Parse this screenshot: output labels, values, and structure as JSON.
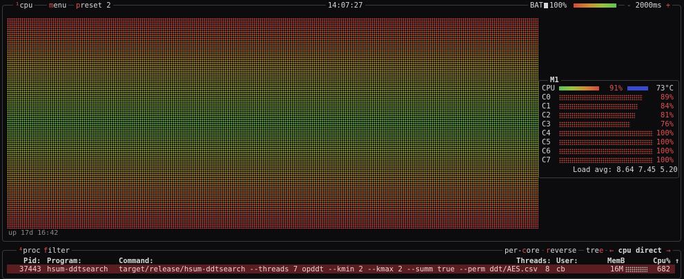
{
  "top": {
    "cpu_hotkey": "¹",
    "cpu_label": "cpu",
    "menu_hotkey": "m",
    "menu_rest": "enu",
    "preset_hotkey": "p",
    "preset_rest": "reset 2",
    "clock": "14:07:27",
    "battery_label": "BAT",
    "battery_pct": "100%",
    "minus": "-",
    "interval": "2000ms",
    "plus": "+"
  },
  "graph": {
    "uptime": "up 17d 16:42"
  },
  "cpu_panel": {
    "title": "M1",
    "cpu_label": "CPU",
    "cpu_pct": "91%",
    "temp": "73°C",
    "cores": [
      {
        "name": "C0",
        "pct": "89%",
        "level": 0.89
      },
      {
        "name": "C1",
        "pct": "84%",
        "level": 0.84
      },
      {
        "name": "C2",
        "pct": "81%",
        "level": 0.81
      },
      {
        "name": "C3",
        "pct": "76%",
        "level": 0.76
      },
      {
        "name": "C4",
        "pct": "100%",
        "level": 1.0
      },
      {
        "name": "C5",
        "pct": "100%",
        "level": 1.0
      },
      {
        "name": "C6",
        "pct": "100%",
        "level": 1.0
      },
      {
        "name": "C7",
        "pct": "100%",
        "level": 1.0
      }
    ],
    "load_avg_label": "Load avg:",
    "load_avg": "8.64 7.45 5.20"
  },
  "proc": {
    "proc_hotkey": "⁴",
    "proc_label": "proc",
    "filter_hotkey": "f",
    "filter_rest": "ilter",
    "per_core_a": "per-",
    "per_core_hotkey": "c",
    "per_core_b": "ore",
    "reverse_hotkey": "r",
    "reverse_rest": "everse",
    "tree_a": "tre",
    "tree_hotkey": "e",
    "sort_left": "←",
    "sort_label": "cpu direct",
    "sort_right": "→",
    "headers": {
      "pid": "Pid:",
      "program": "Program:",
      "command": "Command:",
      "threads": "Threads:",
      "user": "User:",
      "memb": "MemB",
      "cpu": "Cpu%",
      "arrow": "↑"
    },
    "row": {
      "pid": "37443",
      "program": "hsum-ddtsearch",
      "command": "target/release/hsum-ddtsearch --threads 7 opddt --kmin 2 --kmax 2 --summ true --perm ddt/AES.csv",
      "threads": "8",
      "user": "cb",
      "memb": "16M",
      "cpu": "682"
    }
  },
  "colors": {
    "accent": "#e05050",
    "border": "#3a3a3a",
    "selected_row": "#5a1e22"
  }
}
